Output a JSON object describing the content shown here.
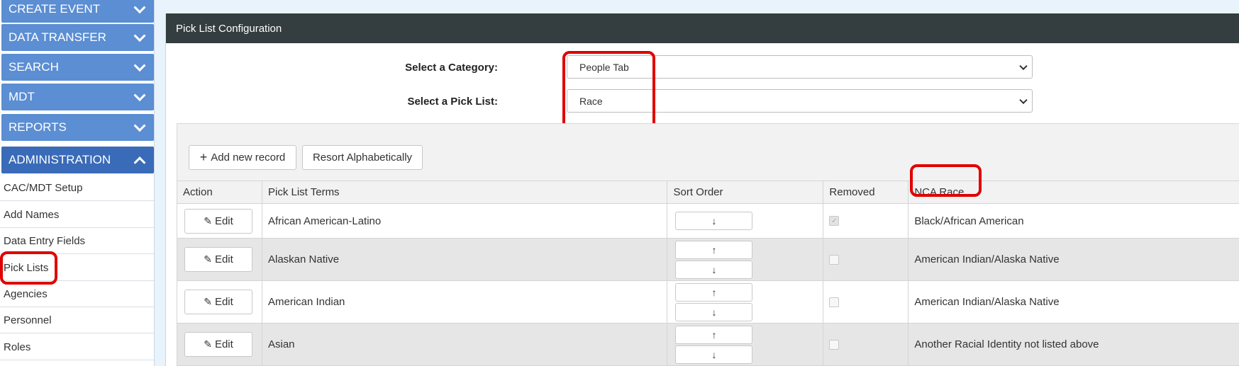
{
  "sidebar": {
    "menus": [
      {
        "label": "CREATE EVENT",
        "icon": "chevron-down-icon"
      },
      {
        "label": "DATA TRANSFER",
        "icon": "chevron-down-icon"
      },
      {
        "label": "SEARCH",
        "icon": "chevron-down-icon"
      },
      {
        "label": "MDT",
        "icon": "chevron-down-icon"
      },
      {
        "label": "REPORTS",
        "icon": "chevron-down-icon"
      },
      {
        "label": "ADMINISTRATION",
        "icon": "chevron-up-icon"
      }
    ],
    "links": [
      "CAC/MDT Setup",
      "Add Names",
      "Data Entry Fields",
      "Pick Lists",
      "Agencies",
      "Personnel",
      "Roles"
    ]
  },
  "panel": {
    "title": "Pick List Configuration",
    "category_label": "Select a Category:",
    "category_value": "People Tab",
    "picklist_label": "Select a Pick List:",
    "picklist_value": "Race"
  },
  "toolbar": {
    "add_plus": "+",
    "add_label": "Add new record",
    "resort_label": "Resort Alphabetically"
  },
  "table": {
    "headers": [
      "Action",
      "Pick List Terms",
      "Sort Order",
      "Removed",
      "NCA Race"
    ],
    "edit_label": "Edit",
    "up_arrow": "↑",
    "down_arrow": "↓",
    "rows": [
      {
        "term": "African American-Latino",
        "removed": true,
        "nca": "Black/African American"
      },
      {
        "term": "Alaskan Native",
        "removed": false,
        "nca": "American Indian/Alaska Native"
      },
      {
        "term": "American Indian",
        "removed": false,
        "nca": "American Indian/Alaska Native"
      },
      {
        "term": "Asian",
        "removed": false,
        "nca": "Another Racial Identity not listed above"
      }
    ]
  },
  "colors": {
    "nav_blue": "#5b8ed3",
    "nav_active": "#3a6bb8",
    "header_dark": "#343d3f",
    "highlight_red": "#e00000"
  }
}
